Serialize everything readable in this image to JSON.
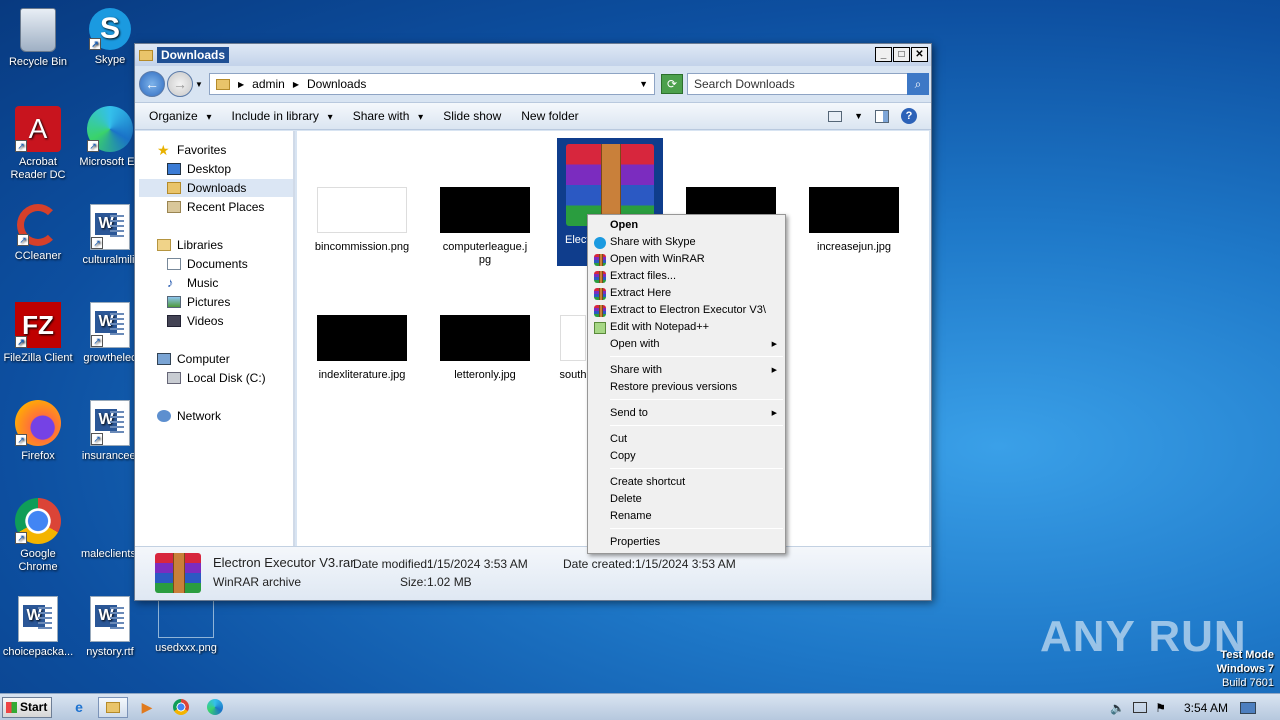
{
  "desktop": {
    "icons": [
      {
        "label": "Recycle Bin"
      },
      {
        "label": "Skype"
      },
      {
        "label": "Acrobat Reader DC"
      },
      {
        "label": "Microsoft Ed"
      },
      {
        "label": "CCleaner"
      },
      {
        "label": "culturalmilit"
      },
      {
        "label": "FileZilla Client"
      },
      {
        "label": "growthelec"
      },
      {
        "label": "Firefox"
      },
      {
        "label": "insuranceei"
      },
      {
        "label": "Google Chrome"
      },
      {
        "label": "maleclients."
      },
      {
        "label": "choicepacka..."
      },
      {
        "label": "nystory.rtf"
      },
      {
        "label": "usedxxx.png"
      }
    ]
  },
  "window": {
    "title": "Downloads",
    "breadcrumb": [
      "admin",
      "Downloads"
    ],
    "search_placeholder": "Search Downloads",
    "toolbar": {
      "organize": "Organize",
      "include_library": "Include in library",
      "share_with": "Share with",
      "slide_show": "Slide show",
      "new_folder": "New folder"
    },
    "nav": {
      "favorites": "Favorites",
      "desktop": "Desktop",
      "downloads": "Downloads",
      "recent": "Recent Places",
      "libraries": "Libraries",
      "documents": "Documents",
      "music": "Music",
      "pictures": "Pictures",
      "videos": "Videos",
      "computer": "Computer",
      "local_disk": "Local Disk (C:)",
      "network": "Network"
    },
    "files": [
      {
        "name": "bincommission.png"
      },
      {
        "name": "computerleague.jpg"
      },
      {
        "name": "Elect"
      },
      {
        "name": ""
      },
      {
        "name": "increasejun.jpg"
      },
      {
        "name": "indexliterature.jpg"
      },
      {
        "name": "letteronly.jpg"
      },
      {
        "name": "south"
      }
    ],
    "status": {
      "filename": "Electron Executor V3.rar",
      "type": "WinRAR archive",
      "modified_label": "Date modified:",
      "modified": "1/15/2024 3:53 AM",
      "size_label": "Size:",
      "size": "1.02 MB",
      "created_label": "Date created:",
      "created": "1/15/2024 3:53 AM"
    }
  },
  "context_menu": {
    "open": "Open",
    "share_skype": "Share with Skype",
    "open_winrar": "Open with WinRAR",
    "extract_files": "Extract files...",
    "extract_here": "Extract Here",
    "extract_to": "Extract to Electron Executor V3\\",
    "edit_notepad": "Edit with Notepad++",
    "open_with": "Open with",
    "share_with": "Share with",
    "restore": "Restore previous versions",
    "send_to": "Send to",
    "cut": "Cut",
    "copy": "Copy",
    "create_shortcut": "Create shortcut",
    "delete": "Delete",
    "rename": "Rename",
    "properties": "Properties"
  },
  "taskbar": {
    "start": "Start",
    "clock": "3:54 AM"
  },
  "watermark": "ANY RUN",
  "test_mode": {
    "line1": "Test Mode",
    "line2": "Windows 7",
    "line3": "Build 7601"
  }
}
